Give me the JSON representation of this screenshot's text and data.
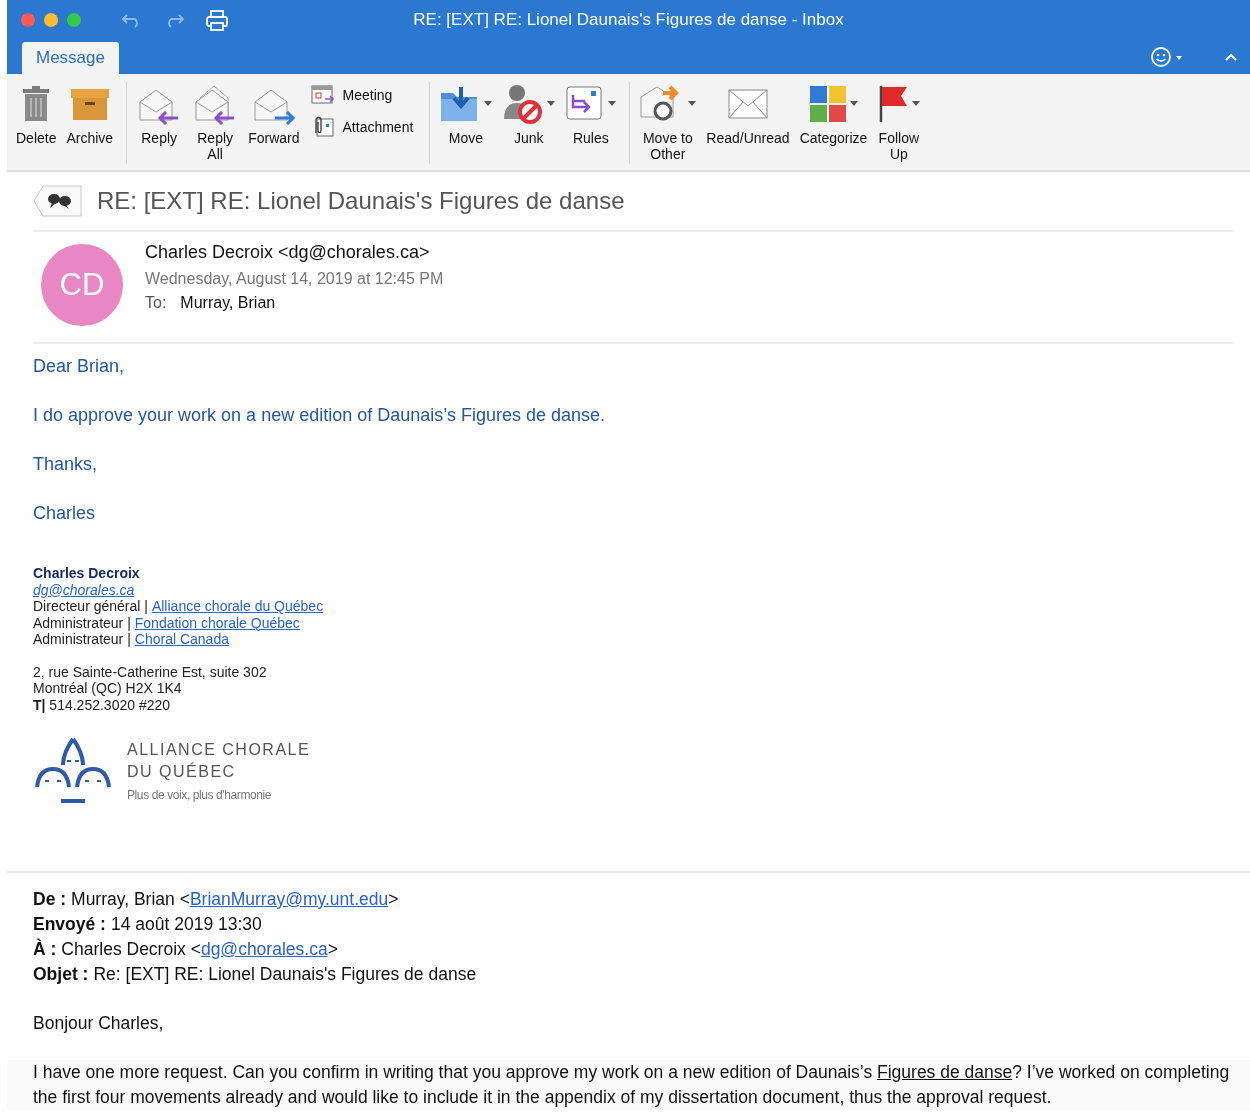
{
  "window": {
    "title": "RE: [EXT] RE: Lionel Daunais's Figures de danse - Inbox"
  },
  "tabs": [
    {
      "label": "Message",
      "selected": true
    }
  ],
  "toolbar": {
    "groups": [
      {
        "items": [
          {
            "kind": "large",
            "label": "Delete",
            "dropdown": false
          },
          {
            "kind": "large",
            "label": "Archive",
            "dropdown": false
          }
        ]
      },
      {
        "items": [
          {
            "kind": "large",
            "label": "Reply",
            "dropdown": false
          },
          {
            "kind": "large",
            "label": "Reply\nAll",
            "dropdown": false
          },
          {
            "kind": "large",
            "label": "Forward",
            "dropdown": false
          },
          {
            "kind": "stack",
            "subitems": [
              {
                "label": "Meeting"
              },
              {
                "label": "Attachment"
              }
            ]
          }
        ]
      },
      {
        "items": [
          {
            "kind": "large",
            "label": "Move",
            "dropdown": true
          },
          {
            "kind": "large",
            "label": "Junk",
            "dropdown": true
          },
          {
            "kind": "large",
            "label": "Rules",
            "dropdown": true
          }
        ]
      },
      {
        "items": [
          {
            "kind": "large",
            "label": "Move to\nOther",
            "dropdown": true
          },
          {
            "kind": "large",
            "label": "Read/Unread",
            "dropdown": false
          },
          {
            "kind": "large",
            "label": "Categorize",
            "dropdown": true
          },
          {
            "kind": "large",
            "label": "Follow\nUp",
            "dropdown": true
          }
        ]
      }
    ]
  },
  "message": {
    "subject": "RE: [EXT] RE: Lionel Daunais's Figures de danse",
    "avatar": {
      "initials": "CD",
      "color": "#e887c4"
    },
    "sender": "Charles Decroix <dg@chorales.ca>",
    "date": "Wednesday, August 14, 2019 at 12:45 PM",
    "to_label": "To:",
    "to": "Murray, Brian",
    "body": [
      "Dear Brian,",
      "I do approve your work on a new edition of Daunais’s Figures de danse.",
      "Thanks,",
      "Charles"
    ],
    "signature": {
      "name": "Charles Decroix",
      "email": "dg@chorales.ca",
      "roles": [
        {
          "title": "Directeur général |",
          "org": "Alliance chorale du Québec"
        },
        {
          "title": "Administrateur |",
          "org": "Fondation chorale Québec"
        },
        {
          "title": "Administrateur |",
          "org": "Choral Canada"
        }
      ],
      "address": [
        "2, rue Sainte-Catherine Est, suite 302",
        "Montréal (QC) H2X 1K4"
      ],
      "phone": "**T|** 514.252.3020 #220",
      "logo": {
        "line1": "ALLIANCE CHORALE",
        "line2": "DU QUÉBEC",
        "tagline": "Plus de voix, plus d'harmonie"
      }
    }
  },
  "quoted": {
    "headers": [
      {
        "label": "De :",
        "before": "Murray, Brian <",
        "link": "BrianMurray@my.unt.edu",
        "after": ">"
      },
      {
        "label": "Envoyé :",
        "before": "14 août 2019 13:30"
      },
      {
        "label": "À :",
        "before": "Charles Decroix <",
        "link": "dg@chorales.ca",
        "after": ">"
      },
      {
        "label": "Objet :",
        "before": "Re: [EXT] RE: Lionel Daunais's Figures de danse"
      }
    ],
    "greeting": "Bonjour Charles,",
    "paragraph": {
      "before": "I have one more request. Can you confirm in writing that you approve my work on a new edition of Daunais’s ",
      "underlined": "Figures de danse",
      "after": "? I’ve worked on completing the first four movements already and would like to include it in the appendix of my dissertation document, thus the approval request."
    }
  }
}
